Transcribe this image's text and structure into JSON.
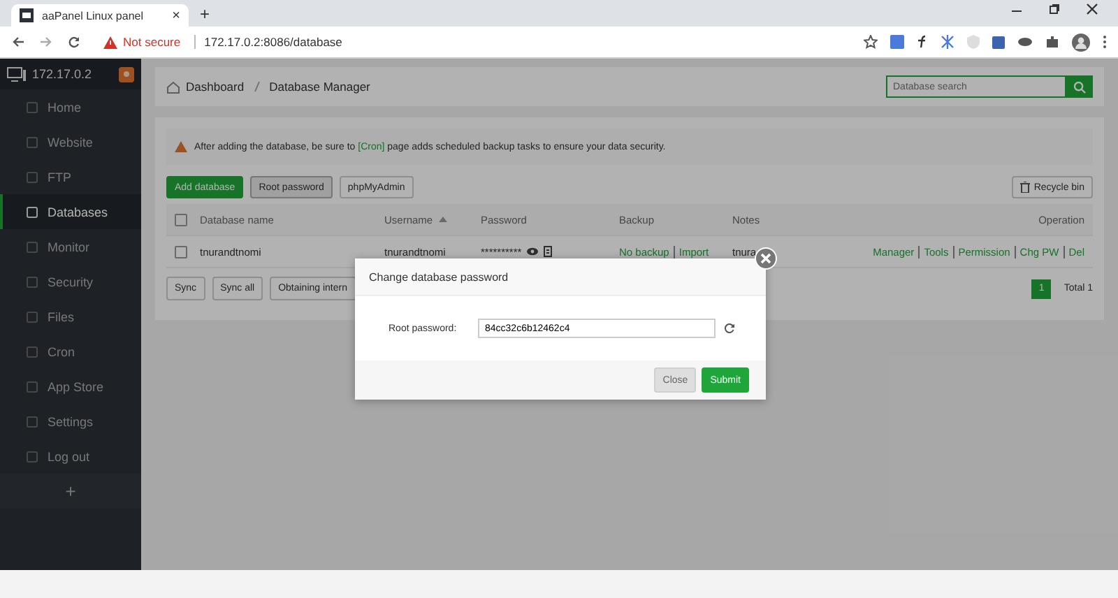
{
  "browser": {
    "tab_title": "aaPanel Linux panel",
    "tab_close": "×",
    "new_tab": "+",
    "security": "Not secure",
    "url": "172.17.0.2:8086/database"
  },
  "sidebar": {
    "host": "172.17.0.2",
    "items": [
      {
        "label": "Home",
        "selected": false
      },
      {
        "label": "Website",
        "selected": false
      },
      {
        "label": "FTP",
        "selected": false
      },
      {
        "label": "Databases",
        "selected": true
      },
      {
        "label": "Monitor",
        "selected": false
      },
      {
        "label": "Security",
        "selected": false
      },
      {
        "label": "Files",
        "selected": false
      },
      {
        "label": "Cron",
        "selected": false
      },
      {
        "label": "App Store",
        "selected": false
      },
      {
        "label": "Settings",
        "selected": false
      },
      {
        "label": "Log out",
        "selected": false
      }
    ],
    "add": "+"
  },
  "breadcrumb": [
    "Dashboard",
    "Database Manager"
  ],
  "search": {
    "placeholder": "Database search"
  },
  "notice": {
    "before": "After adding the database, be sure to",
    "link": "[Cron]",
    "after": "page adds scheduled backup tasks to ensure your data security."
  },
  "toolbar": {
    "buttons": [
      {
        "label": "Add database",
        "kind": "primary"
      },
      {
        "label": "Root password",
        "kind": "pressed"
      },
      {
        "label": "phpMyAdmin",
        "kind": "default"
      }
    ],
    "recycle": "Recycle bin"
  },
  "table": {
    "columns": [
      "Database name",
      "Username",
      "Password",
      "Backup",
      "Notes",
      "Operation"
    ],
    "all_checked": false,
    "rows": [
      {
        "checked": false,
        "name": "tnurandtnomi",
        "username": "tnurandtnomi",
        "password": "**********",
        "backup": [
          "No backup",
          "Import"
        ],
        "notes": "tnura",
        "operations": [
          "Manager",
          "Tools",
          "Permission",
          "Chg PW",
          "Del"
        ]
      }
    ]
  },
  "table_actions": [
    "Sync",
    "Sync all",
    "Obtaining intern"
  ],
  "pagination": {
    "page": "1",
    "total": "Total 1"
  },
  "modal": {
    "title": "Change database password",
    "field_label": "Root password:",
    "value": "84cc32c6b12462c4",
    "buttons": [
      {
        "label": "Close",
        "kind": "muted"
      },
      {
        "label": "Submit",
        "kind": "primary"
      }
    ]
  }
}
